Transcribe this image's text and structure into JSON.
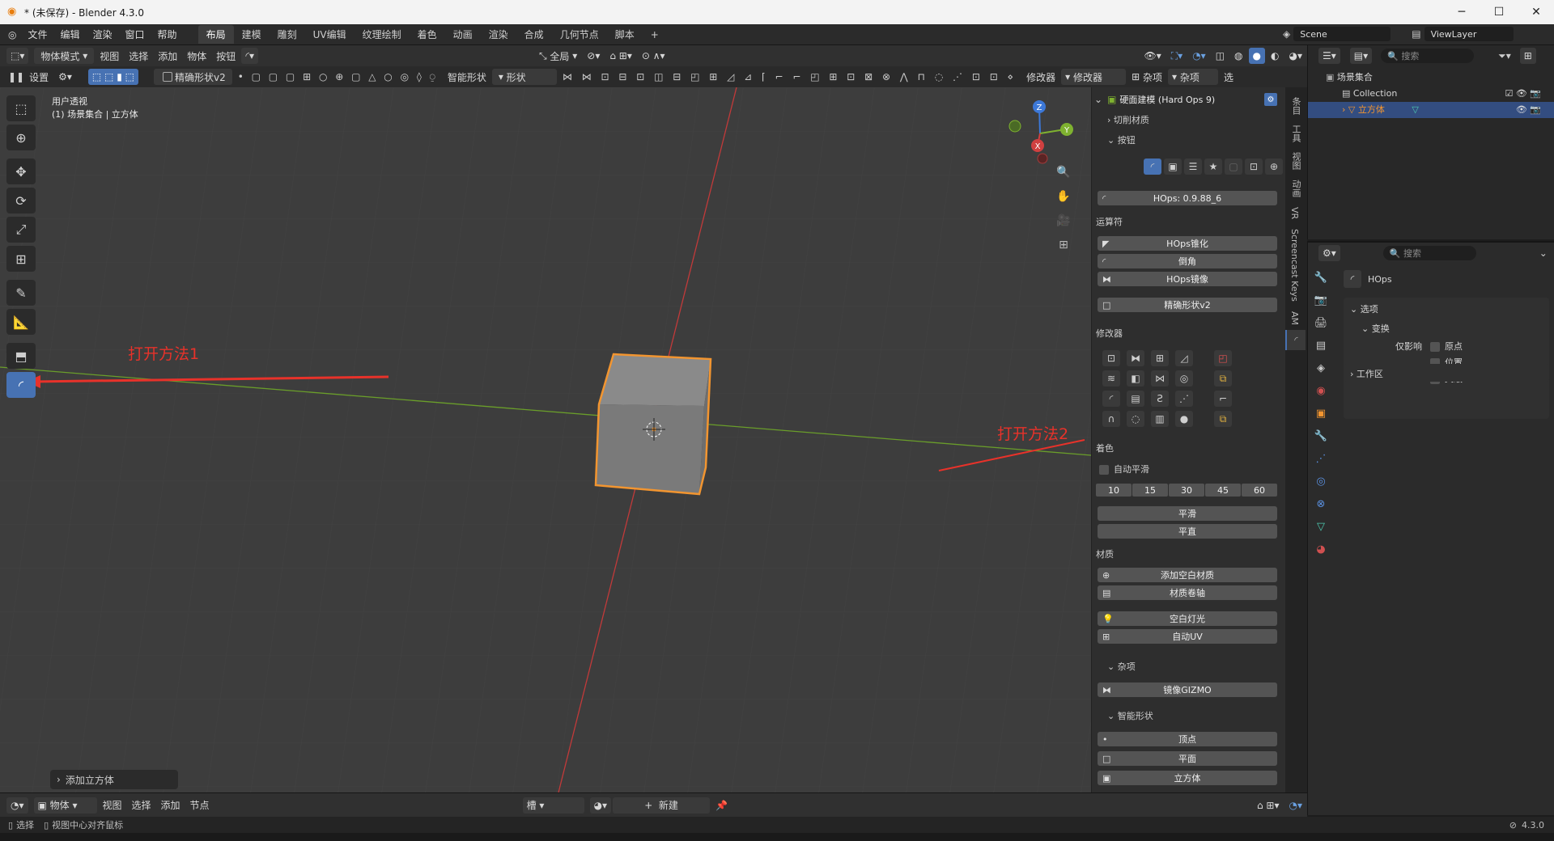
{
  "window": {
    "title": "* (未保存) - Blender 4.3.0",
    "minimize": "─",
    "maximize": "☐",
    "close": "✕"
  },
  "menu": {
    "items": [
      "文件",
      "编辑",
      "渲染",
      "窗口",
      "帮助"
    ],
    "workspaces": [
      "布局",
      "建模",
      "雕刻",
      "UV编辑",
      "纹理绘制",
      "着色",
      "动画",
      "渲染",
      "合成",
      "几何节点",
      "脚本"
    ],
    "add_tab": "+",
    "scene_label": "Scene",
    "viewlayer_label": "ViewLayer"
  },
  "viewport_header": {
    "mode": "物体模式",
    "menus": [
      "视图",
      "选择",
      "添加",
      "物体",
      "按钮"
    ],
    "transform_orientation": "全局"
  },
  "tool_settings": {
    "settings_label": "设置",
    "tool_name": "精确形状v2",
    "smart_shape": "智能形状",
    "shape_label": "形状",
    "modifier_label": "修改器",
    "modifier_dropdown": "修改器",
    "misc_label": "杂项",
    "misc_dropdown": "杂项",
    "right_tab": "选"
  },
  "viewport": {
    "view_name": "用户透视",
    "collection_info": "(1) 场景集合 | 立方体",
    "gizmo": {
      "x": "X",
      "y": "Y",
      "z": "Z"
    },
    "last_op": "添加立方体"
  },
  "annotations": {
    "method1": "打开方法1",
    "method2": "打开方法2",
    "color": "#e8322a"
  },
  "npanel": {
    "title": "硬面建模 (Hard Ops 9)",
    "cut_mat": "切削材质",
    "buttons_section": "按钮",
    "version_btn": "HOps: 0.9.88_6",
    "operators_label": "运算符",
    "ops": [
      "HOps锥化",
      "倒角",
      "HOps镜像"
    ],
    "precise_btn": "精确形状v2",
    "modifiers_label": "修改器",
    "shading_label": "着色",
    "auto_smooth": "自动平滑",
    "angles": [
      "10",
      "15",
      "30",
      "45",
      "60"
    ],
    "smooth_btn": "平滑",
    "flat_btn": "平直",
    "material_label": "材质",
    "add_blank_mat": "添加空白材质",
    "mat_scroll": "材质卷轴",
    "blank_light": "空白灯光",
    "auto_uv": "自动UV",
    "misc_section": "杂项",
    "mirror_gizmo": "镜像GIZMO",
    "smart_shape_section": "智能形状",
    "smart_shapes": [
      "顶点",
      "平面",
      "立方体"
    ],
    "tabs": [
      "条目",
      "工具",
      "视图",
      "动画",
      "VR",
      "Screencast Keys",
      "AM"
    ]
  },
  "outliner": {
    "search_placeholder": "搜索",
    "scene_collection": "场景集合",
    "collection": "Collection",
    "object": "立方体"
  },
  "properties": {
    "search_placeholder": "搜索",
    "title": "HOps",
    "options": "选项",
    "transform": "变换",
    "affect_only": "仅影响",
    "origin": "原点",
    "location": "位置",
    "parent": "父级",
    "workspace": "工作区"
  },
  "bottom_header": {
    "object_mode": "物体",
    "menus": [
      "视图",
      "选择",
      "添加",
      "节点"
    ],
    "slot": "槽",
    "new_btn": "新建"
  },
  "statusbar": {
    "select": "选择",
    "center_view": "视图中心对齐鼠标",
    "version": "4.3.0"
  },
  "colors": {
    "accent": "#4772b3",
    "selection": "#f29530",
    "viewport_bg": "#3d3d3d",
    "x_axis": "#c23a3a",
    "y_axis": "#6a9e2a"
  }
}
